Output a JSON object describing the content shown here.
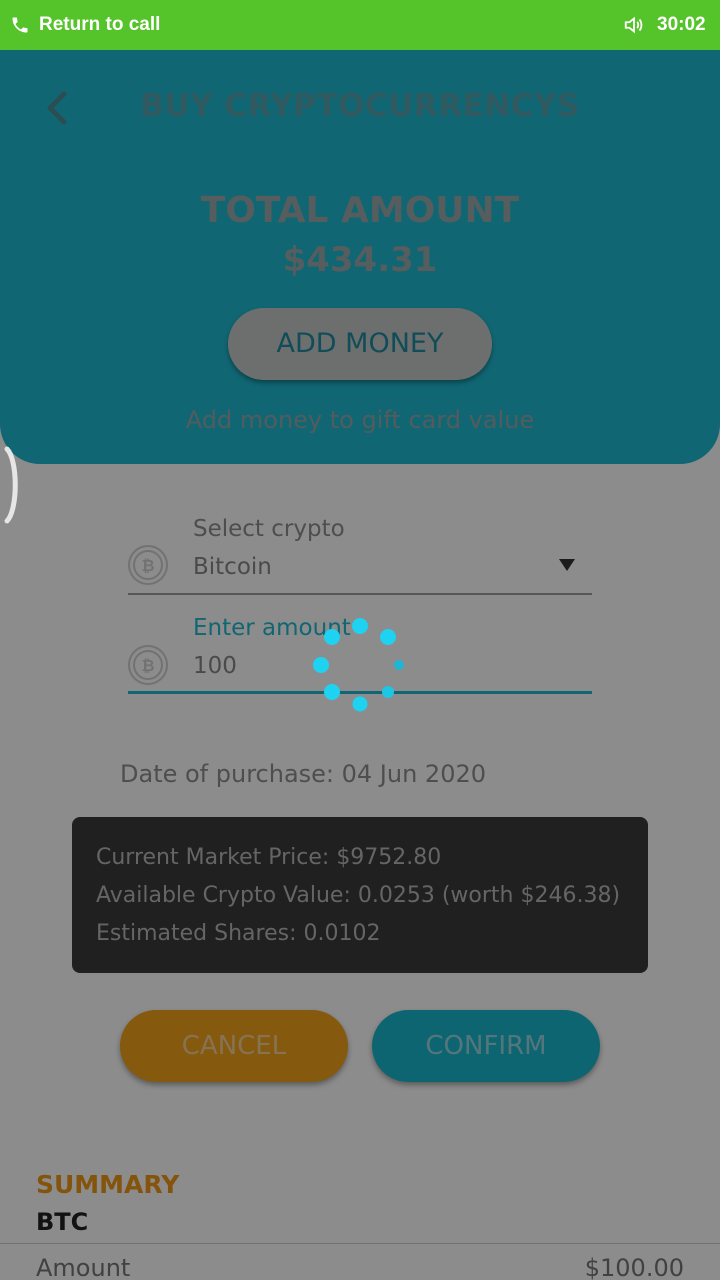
{
  "status_bar": {
    "return_label": "Return to call",
    "time": "30:02",
    "bar_color": "#55c32a",
    "phone_icon": "phone-icon",
    "volume_icon": "volume-icon"
  },
  "header": {
    "title": "BUY CRYPTOCURRENCYS",
    "total_label": "TOTAL AMOUNT",
    "total_value": "$434.31",
    "add_money_label": "ADD MONEY",
    "add_money_hint": "Add money to gift card value",
    "accent_color": "#1ebbd1"
  },
  "form": {
    "crypto_label": "Select crypto",
    "crypto_value": "Bitcoin",
    "amount_label": "Enter amount",
    "amount_value": "100",
    "purchase_date": "Date of purchase: 04 Jun 2020",
    "coin_icon": "bitcoin-icon"
  },
  "info": {
    "market_price": "Current Market Price: $9752.80",
    "available_value": "Available Crypto Value: 0.0253 (worth $246.38)",
    "estimated_shares": "Estimated Shares: 0.0102"
  },
  "actions": {
    "cancel_label": "CANCEL",
    "confirm_label": "CONFIRM",
    "cancel_color": "#f3a21b",
    "confirm_color": "#1ab8cf"
  },
  "summary": {
    "title": "SUMMARY",
    "coin": "BTC",
    "amount_label": "Amount",
    "amount_value": "$100.00"
  },
  "loading": {
    "spinner_icon": "loading-spinner-icon"
  }
}
